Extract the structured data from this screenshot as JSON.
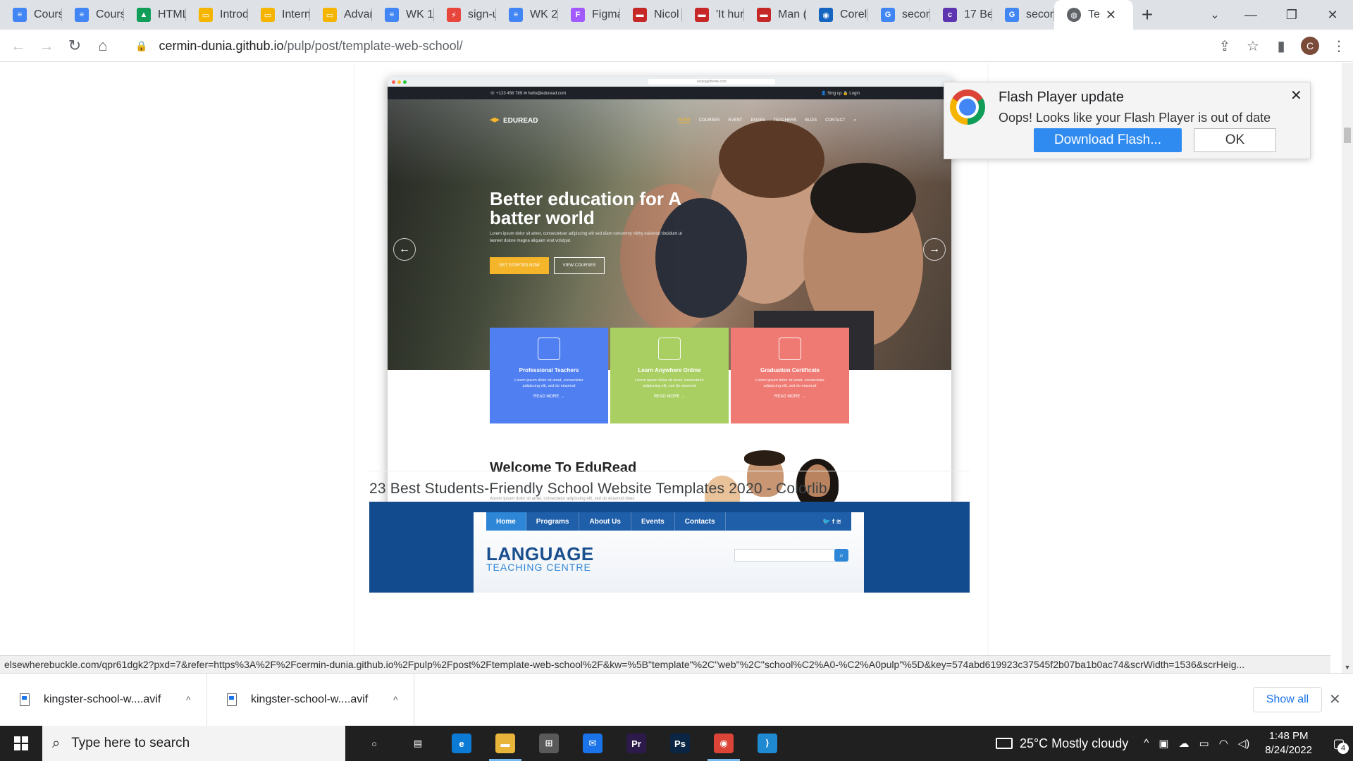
{
  "browser": {
    "tabs": [
      {
        "label": "Cours",
        "icon": "google-docs-icon",
        "color": "#4285f4",
        "glyph": "≡"
      },
      {
        "label": "Cours",
        "icon": "google-docs-icon",
        "color": "#4285f4",
        "glyph": "≡"
      },
      {
        "label": "HTML",
        "icon": "google-drive-icon",
        "color": "#0f9d58",
        "glyph": "▲"
      },
      {
        "label": "Introd",
        "icon": "google-slides-icon",
        "color": "#f4b400",
        "glyph": "▭"
      },
      {
        "label": "Intern",
        "icon": "google-slides-icon",
        "color": "#f4b400",
        "glyph": "▭"
      },
      {
        "label": "Advar",
        "icon": "google-slides-icon",
        "color": "#f4b400",
        "glyph": "▭"
      },
      {
        "label": "WK 1",
        "icon": "google-docs-icon",
        "color": "#4285f4",
        "glyph": "≡"
      },
      {
        "label": "sign-u",
        "icon": "sign-up-icon",
        "color": "#e8453c",
        "glyph": "⚡"
      },
      {
        "label": "WK 2",
        "icon": "google-docs-icon",
        "color": "#4285f4",
        "glyph": "≡"
      },
      {
        "label": "Figma",
        "icon": "figma-icon",
        "color": "#a259ff",
        "glyph": "F"
      },
      {
        "label": "Nicol",
        "icon": "site-icon",
        "color": "#c62828",
        "glyph": "▬"
      },
      {
        "label": "'It hur",
        "icon": "site-icon",
        "color": "#c62828",
        "glyph": "▬"
      },
      {
        "label": "Man (",
        "icon": "site-icon",
        "color": "#c62828",
        "glyph": "▬"
      },
      {
        "label": "Corel",
        "icon": "coreldraw-icon",
        "color": "#1565c0",
        "glyph": "◉"
      },
      {
        "label": "secon",
        "icon": "google-icon",
        "color": "#4285f4",
        "glyph": "G"
      },
      {
        "label": "17 Be",
        "icon": "colorlib-icon",
        "color": "#5e35b1",
        "glyph": "c"
      },
      {
        "label": "secon",
        "icon": "google-icon",
        "color": "#4285f4",
        "glyph": "G"
      }
    ],
    "active_tab": {
      "label": "Te",
      "icon": "globe-icon"
    },
    "url_host": "cermin-dunia.github.io",
    "url_path": "/pulp/post/template-web-school/",
    "profile_initial": "C"
  },
  "mockup": {
    "browser_url": "ecologytheme.com",
    "topbar_left": "☏ +123 456 789   ✉ hello@eduread.com",
    "topbar_right": "👤 Sing up   🔒 Login",
    "logo": "EDUREAD",
    "menu": [
      "HOME",
      "COURSES",
      "EVENT",
      "PAGES",
      "TEACHERS",
      "BLOG",
      "CONTACT",
      "⌕"
    ],
    "headline": "Better education for A batter world",
    "lead": "Lorem ipsum dolor sit amet, consectetuer adipiscing elit sed diam nonummy nibhy euismod tincidunt ut laoreet dolore magna aliquam erat volutpat.",
    "btn_primary": "GET STARTED NOW",
    "btn_secondary": "VIEW COURSES",
    "cards": [
      {
        "title": "Professional Teachers",
        "desc": "Lorem ipsum dolor sit amet, consectetur adipiscing elit, sed do eiusmod",
        "link": "READ MORE →",
        "color": "#4f7ff0"
      },
      {
        "title": "Learn Anywhere Online",
        "desc": "Lorem ipsum dolor sit amet, consectetur adipiscing elit, sed do eiusmod",
        "link": "READ MORE →",
        "color": "#a9cf63"
      },
      {
        "title": "Graduation Certificate",
        "desc": "Lorem ipsum dolor sit amet, consectetur adipiscing elit, sed do eiusmod",
        "link": "READ MORE →",
        "color": "#ef7a73"
      }
    ],
    "welcome": "Welcome To EduRead",
    "welcome_lead": "Aorem ipsum dolor sit amet, consectetur adipiscing elit, sed do eiusmod does"
  },
  "article": {
    "caption": "23 Best Students-Friendly School Website Templates 2020 - Colorlib"
  },
  "language_site": {
    "nav": [
      "Home",
      "Programs",
      "About Us",
      "Events",
      "Contacts"
    ],
    "social": "🐦  f  ≋",
    "title": "LANGUAGE",
    "subtitle": "TEACHING CENTRE"
  },
  "flash_popup": {
    "title": "Flash Player update",
    "message": "Oops! Looks like your Flash Player is out of date",
    "download_label": "Download Flash...",
    "ok_label": "OK"
  },
  "status_url": "elsewherebuckle.com/qpr61dgk2?pxd=7&refer=https%3A%2F%2Fcermin-dunia.github.io%2Fpulp%2Fpost%2Ftemplate-web-school%2F&kw=%5B\"template\"%2C\"web\"%2C\"school%C2%A0-%C2%A0pulp\"%5D&key=574abd619923c37545f2b07ba1b0ac74&scrWidth=1536&scrHeig...",
  "downloads": [
    {
      "name": "kingster-school-w....avif"
    },
    {
      "name": "kingster-school-w....avif"
    }
  ],
  "downloads_show_all": "Show all",
  "taskbar": {
    "search_placeholder": "Type here to search",
    "apps": [
      {
        "name": "task-view",
        "glyph": "○",
        "color": "transparent"
      },
      {
        "name": "widgets",
        "glyph": "▤",
        "color": "transparent"
      },
      {
        "name": "edge",
        "glyph": "e",
        "color": "#0c7bd6"
      },
      {
        "name": "file-explorer",
        "glyph": "▬",
        "color": "#e8b43a"
      },
      {
        "name": "store",
        "glyph": "⊞",
        "color": "#5a5a5a"
      },
      {
        "name": "mail",
        "glyph": "✉",
        "color": "#1a73e8"
      },
      {
        "name": "premiere",
        "glyph": "Pr",
        "color": "#2b1a4a"
      },
      {
        "name": "photoshop",
        "glyph": "Ps",
        "color": "#0b2544"
      },
      {
        "name": "chrome",
        "glyph": "◉",
        "color": "#db4437"
      },
      {
        "name": "vscode",
        "glyph": "⟩",
        "color": "#1f8ad2"
      }
    ],
    "weather": "25°C  Mostly cloudy",
    "time": "1:48 PM",
    "date": "8/24/2022",
    "notification_count": "4"
  }
}
